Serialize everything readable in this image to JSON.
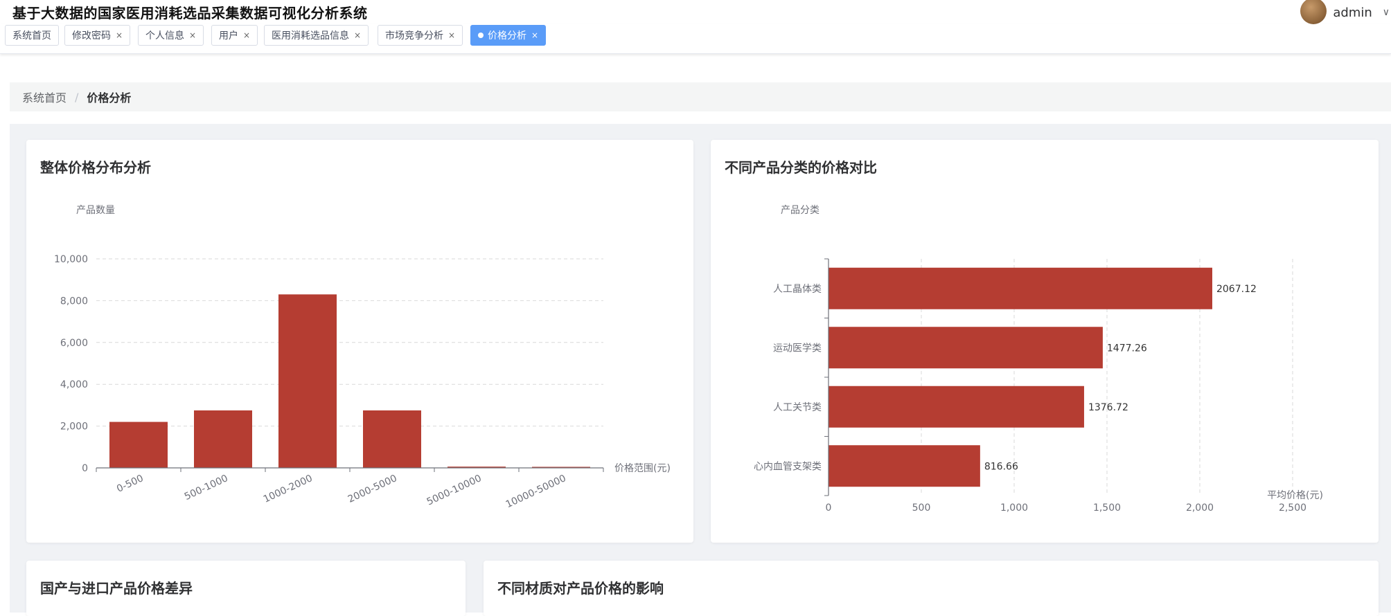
{
  "app": {
    "title": "基于大数据的国家医用消耗选品采集数据可视化分析系统"
  },
  "user": {
    "name": "admin",
    "caret": "∨"
  },
  "tabs": [
    {
      "label": "系统首页",
      "closable": false,
      "active": false
    },
    {
      "label": "修改密码",
      "closable": true,
      "active": false
    },
    {
      "label": "个人信息",
      "closable": true,
      "active": false
    },
    {
      "label": "用户",
      "closable": true,
      "active": false
    },
    {
      "label": "医用消耗选品信息",
      "closable": true,
      "active": false
    },
    {
      "label": "市场竞争分析",
      "closable": true,
      "active": false
    },
    {
      "label": "价格分析",
      "closable": true,
      "active": true
    }
  ],
  "tab_close_symbol": "×",
  "breadcrumb": {
    "home": "系统首页",
    "separator": "/",
    "current": "价格分析"
  },
  "cards": {
    "price_distribution": {
      "title": "整体价格分布分析"
    },
    "category_compare": {
      "title": "不同产品分类的价格对比"
    },
    "domestic_import": {
      "title": "国产与进口产品价格差异"
    },
    "material_effect": {
      "title": "不同材质对产品价格的影响"
    }
  },
  "colors": {
    "bar": "#b53d32",
    "accent": "#5a9cf8",
    "axis": "#6e7079",
    "grid": "#d9d9d9"
  },
  "chart_data": [
    {
      "type": "bar",
      "orientation": "vertical",
      "xlabel": "价格范围(元)",
      "ylabel": "产品数量",
      "categories": [
        "0-500",
        "500-1000",
        "1000-2000",
        "2000-5000",
        "5000-10000",
        "10000-50000"
      ],
      "values": [
        2200,
        2750,
        8300,
        2750,
        60,
        50
      ],
      "ylim": [
        0,
        10000
      ],
      "yticks": [
        0,
        2000,
        4000,
        6000,
        8000,
        10000
      ],
      "ytick_labels": [
        "0",
        "2,000",
        "4,000",
        "6,000",
        "8,000",
        "10,000"
      ],
      "grid": true
    },
    {
      "type": "bar",
      "orientation": "horizontal",
      "xlabel": "平均价格(元)",
      "ylabel": "产品分类",
      "categories": [
        "人工晶体类",
        "运动医学类",
        "人工关节类",
        "心内血管支架类"
      ],
      "values": [
        2067.12,
        1477.26,
        1376.72,
        816.66
      ],
      "value_labels": [
        "2067.12",
        "1477.26",
        "1376.72",
        "816.66"
      ],
      "xlim": [
        0,
        2500
      ],
      "xticks": [
        0,
        500,
        1000,
        1500,
        2000,
        2500
      ],
      "xtick_labels": [
        "0",
        "500",
        "1,000",
        "1,500",
        "2,000",
        "2,500"
      ],
      "grid": true
    }
  ]
}
